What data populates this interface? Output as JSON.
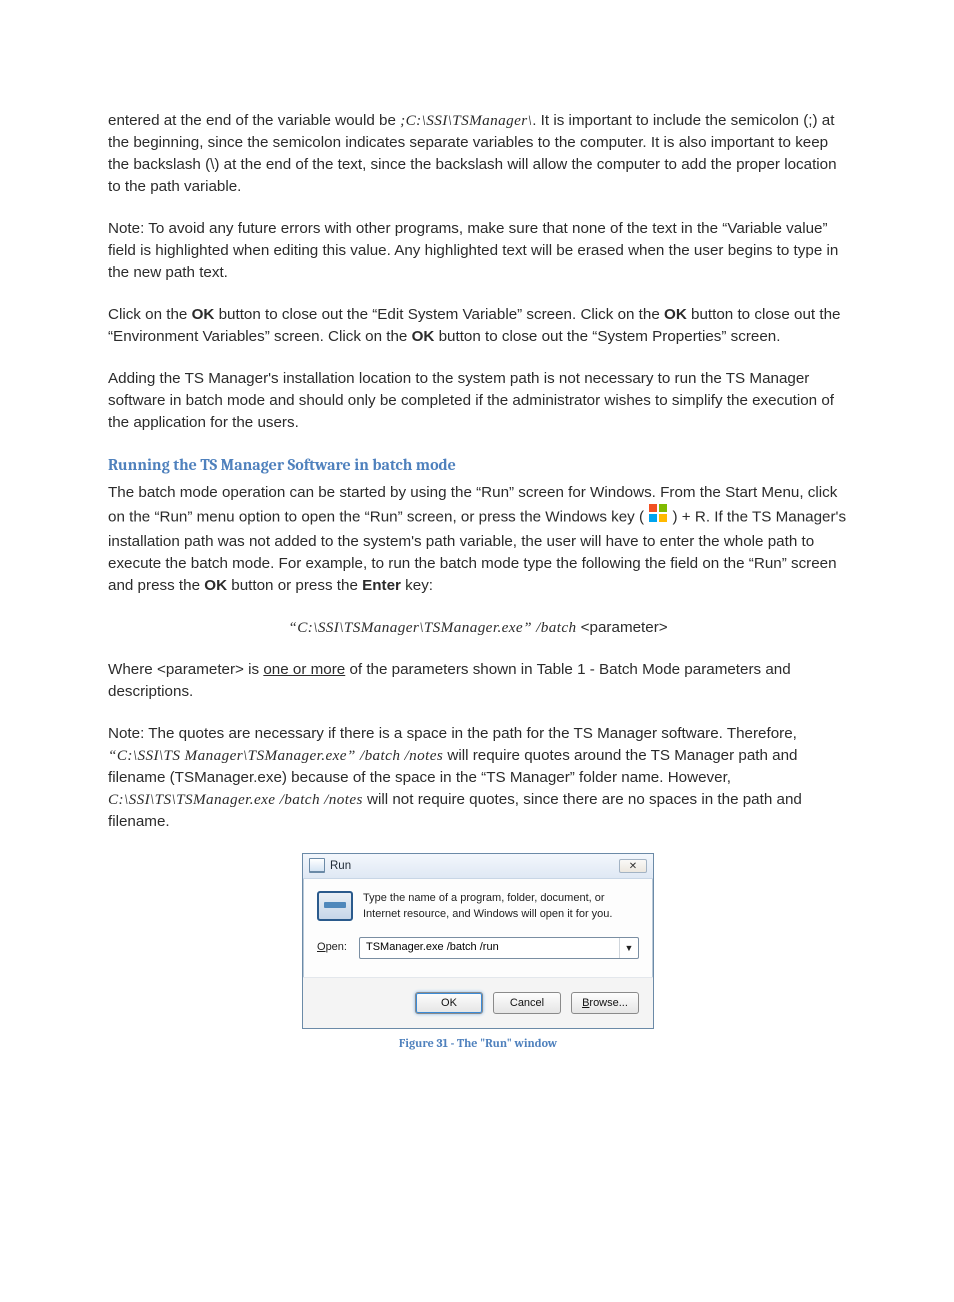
{
  "p1": {
    "a": "entered at the end of the variable would be ",
    "path": ";C:\\SSI\\TSManager\\",
    "b": ".  It is important to include the semicolon (;) at the beginning, since the semicolon indicates separate variables to the computer.  It is also important to keep the backslash (\\) at the end of the text, since the backslash will allow the computer to add the proper location to the path variable."
  },
  "p2": "Note: To avoid any future errors with other programs, make sure that none of the text in the “Variable value” field is highlighted when editing this value.  Any highlighted text will be erased when the user begins to type in the new path text.",
  "p3": {
    "a": "Click on the ",
    "ok": "OK",
    "b": " button to close out the “Edit System Variable” screen.  Click on the ",
    "c": " button to close out the “Environment Variables” screen.  Click on the ",
    "d": " button to close out the “System Properties” screen."
  },
  "p4": "Adding the TS Manager's installation location to the system path is not necessary to run the TS Manager software in batch mode and should only be completed if the administrator wishes to simplify the execution of the application for the users.",
  "h2": "Running the TS Manager Software in batch mode",
  "p5": {
    "a": "The batch mode operation can be started by using the “Run” screen for Windows.  From the Start Menu, click on the “Run” menu option to open the “Run” screen, or press the Windows key ( ",
    "b": " ) + R.  If the TS Manager's installation path was not added to the system's path variable, the user will have to enter the whole path to execute the batch mode.  For example, to run the batch mode type the following the field on the “Run” screen and press the ",
    "ok": "OK",
    "c": " button or press the ",
    "enter": "Enter",
    "d": " key:"
  },
  "cmdline": {
    "ital": "“C:\\SSI\\TSManager\\TSManager.exe” /batch ",
    "rest": "<parameter>"
  },
  "p6": {
    "a": "Where <parameter> is ",
    "u": "one or more",
    "b": " of the parameters shown in Table 1 - Batch Mode parameters and descriptions."
  },
  "p7": {
    "a": "Note: The quotes are necessary if there is a space in the path for the TS Manager software.  Therefore, ",
    "i1": "“C:\\SSI\\TS Manager\\TSManager.exe” /batch /notes",
    "b": " will require quotes around the TS Manager path and filename (TSManager.exe) because of the space in the “TS Manager” folder name.  However, ",
    "i2": "C:\\SSI\\TS\\TSManager.exe /batch /notes",
    "c": " will not require quotes, since there are no spaces in the path and filename."
  },
  "run": {
    "title": "Run",
    "close_glyph": "✕",
    "msg": "Type the name of a program, folder, document, or Internet resource, and Windows will open it for you.",
    "open_label": "Open:",
    "value": "TSManager.exe /batch /run",
    "ok": "OK",
    "cancel": "Cancel",
    "browse": "Browse..."
  },
  "caption": "Figure 31 - The \"Run\" window"
}
